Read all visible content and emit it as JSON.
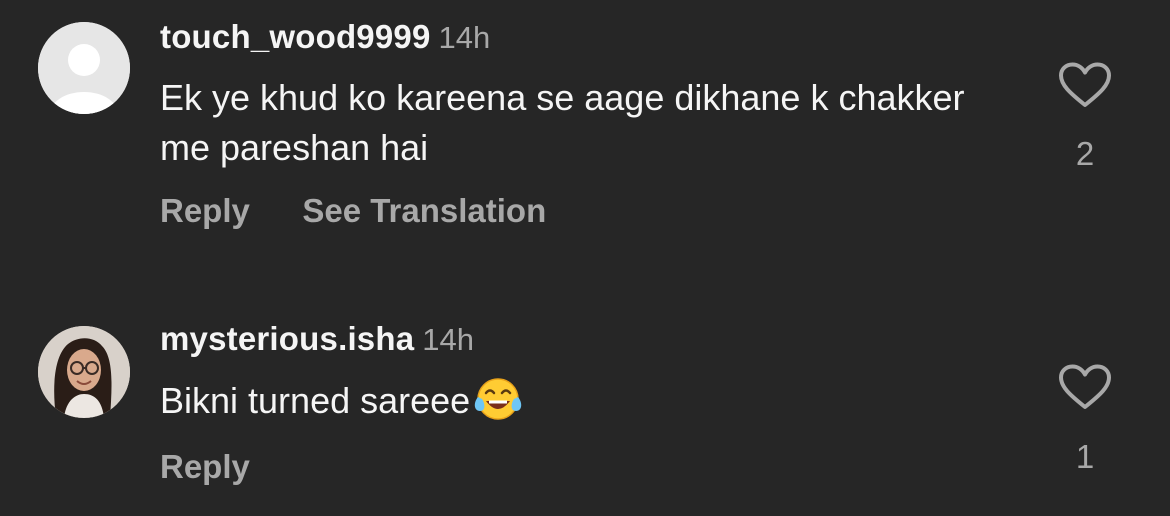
{
  "comments": [
    {
      "username": "touch_wood9999",
      "time": "14h",
      "text": "Ek ye khud ko kareena se aage dikhane k chakker me pareshan hai",
      "actions": [
        "Reply",
        "See Translation"
      ],
      "likes": "2",
      "avatar": "default-avatar-icon"
    },
    {
      "username": "mysterious.isha",
      "time": "14h",
      "text": "Bikni turned sareee",
      "emoji": "face-with-tears-of-joy",
      "actions": [
        "Reply"
      ],
      "likes": "1",
      "avatar": "profile-photo"
    }
  ],
  "colors": {
    "background": "#262626",
    "primary_text": "#f5f5f5",
    "secondary_text": "#a8a8a8"
  }
}
